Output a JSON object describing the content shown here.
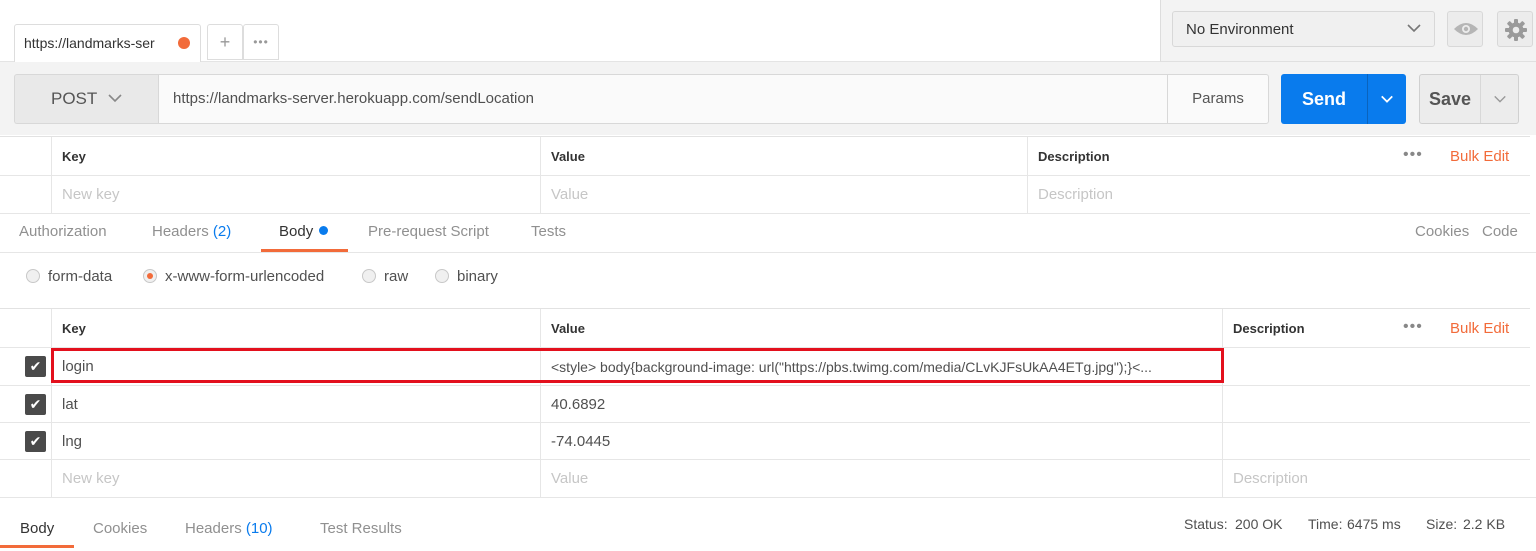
{
  "top_tabs": {
    "active_label": "https://landmarks-ser",
    "add_symbol": "+",
    "more_symbol": "•••"
  },
  "environment": {
    "selected": "No Environment"
  },
  "request": {
    "method": "POST",
    "url": "https://landmarks-server.herokuapp.com/sendLocation",
    "params_label": "Params",
    "send_label": "Send",
    "save_label": "Save"
  },
  "params_table": {
    "col_key": "Key",
    "col_value": "Value",
    "col_description": "Description",
    "bulk_edit": "Bulk Edit",
    "new_key_placeholder": "New key",
    "value_placeholder": "Value",
    "description_placeholder": "Description"
  },
  "sub_tabs": {
    "authorization": "Authorization",
    "headers": "Headers",
    "headers_count": "(2)",
    "body": "Body",
    "prerequest": "Pre-request Script",
    "tests": "Tests",
    "cookies": "Cookies",
    "code": "Code"
  },
  "body_types": {
    "form_data": "form-data",
    "urlencoded": "x-www-form-urlencoded",
    "raw": "raw",
    "binary": "binary",
    "selected": "x-www-form-urlencoded"
  },
  "body_table": {
    "col_key": "Key",
    "col_value": "Value",
    "col_description": "Description",
    "bulk_edit": "Bulk Edit",
    "rows": [
      {
        "key": "login",
        "value": "<style> body{background-image: url(\"https://pbs.twimg.com/media/CLvKJFsUkAA4ETg.jpg\");}<...",
        "checked": true
      },
      {
        "key": "lat",
        "value": "40.6892",
        "checked": true
      },
      {
        "key": "lng",
        "value": "-74.0445",
        "checked": true
      }
    ],
    "new_key_placeholder": "New key",
    "value_placeholder": "Value",
    "description_placeholder": "Description"
  },
  "response": {
    "tab_body": "Body",
    "tab_cookies": "Cookies",
    "tab_headers": "Headers",
    "headers_count": "(10)",
    "tab_tests": "Test Results",
    "status_label": "Status:",
    "status_value": "200 OK",
    "time_label": "Time:",
    "time_value": "6475 ms",
    "size_label": "Size:",
    "size_value": "2.2 KB"
  },
  "colors": {
    "accent": "#f26b3a",
    "send_blue": "#097bed",
    "highlight_red": "#e3101d"
  }
}
